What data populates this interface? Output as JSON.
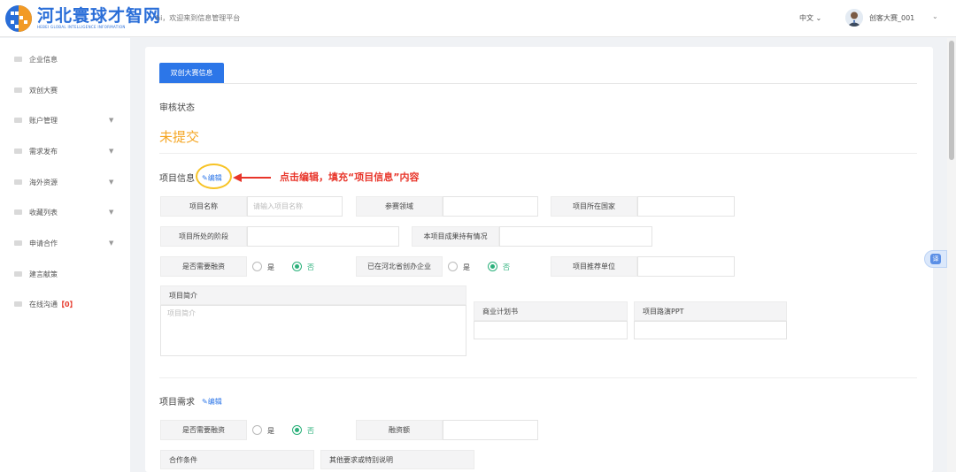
{
  "header": {
    "logo_cn": "河北寰球才智网",
    "logo_en": "HEBEI GLOBAL INTELLIGENCE INFORMATION",
    "welcome": "hi，欢迎来到信息管理平台",
    "language": "中文",
    "username": "创客大赛_001"
  },
  "sidebar": {
    "items": [
      {
        "label": "企业信息",
        "has_submenu": false
      },
      {
        "label": "双创大赛",
        "has_submenu": false
      },
      {
        "label": "账户管理",
        "has_submenu": true
      },
      {
        "label": "需求发布",
        "has_submenu": true
      },
      {
        "label": "海外资源",
        "has_submenu": true
      },
      {
        "label": "收藏列表",
        "has_submenu": true
      },
      {
        "label": "申请合作",
        "has_submenu": true
      },
      {
        "label": "建言献策",
        "has_submenu": false
      },
      {
        "label": "在线沟通",
        "badge": "【0】",
        "has_submenu": false
      }
    ]
  },
  "main": {
    "tab": "双创大赛信息",
    "review": {
      "title": "审核状态",
      "value": "未提交"
    },
    "project_info": {
      "title": "项目信息",
      "edit": "编辑",
      "annotation": "点击编辑，填充“项目信息”内容",
      "fields": {
        "name_label": "项目名称",
        "name_placeholder": "请输入项目名称",
        "domain_label": "参赛领域",
        "country_label": "项目所在国家",
        "stage_label": "项目所处的阶段",
        "ownership_label": "本项目成果持有情况",
        "financing_label": "是否需要融资",
        "hebei_label": "已在河北省创办企业",
        "recommend_label": "项目推荐单位",
        "yes": "是",
        "no": "否",
        "intro_label": "项目简介",
        "intro_placeholder": "项目简介",
        "bp_label": "商业计划书",
        "ppt_label": "项目路演PPT"
      }
    },
    "project_needs": {
      "title": "项目需求",
      "edit": "编辑",
      "financing_label": "是否需要融资",
      "yes": "是",
      "no": "否",
      "amount_label": "融资额",
      "coop_label": "合作条件",
      "other_label": "其他要求或特别说明"
    }
  },
  "float_tab": "译",
  "colors": {
    "primary": "#2c76e8",
    "status_orange": "#f5a623",
    "radio_green": "#2ab07a",
    "annotation_red": "#e8352a",
    "highlight_yellow": "#f7c325"
  }
}
